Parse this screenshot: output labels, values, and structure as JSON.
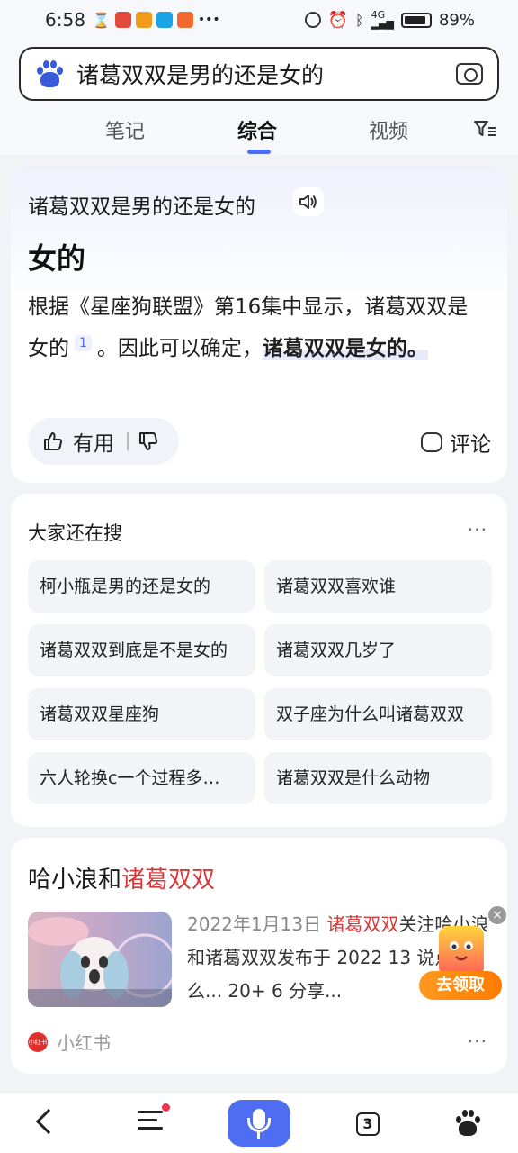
{
  "status_bar": {
    "time": "6:58",
    "battery": "89%",
    "battery_level": 0.89,
    "network": "4G"
  },
  "search": {
    "query": "诸葛双双是男的还是女的"
  },
  "tabs": [
    {
      "label": "笔记"
    },
    {
      "label": "综合",
      "active": true
    },
    {
      "label": "视频"
    }
  ],
  "answer": {
    "question": "诸葛双双是男的还是女的",
    "short_answer": "女的",
    "body_part1": "根据《星座狗联盟》第16集中显示，诸葛双双是女的",
    "citation": "1",
    "body_part2": "。因此可以确定，",
    "body_highlight": "诸葛双双是女的。",
    "useful_label": "有用",
    "comment_label": "评论"
  },
  "related": {
    "title": "大家还在搜",
    "more": "···",
    "items": [
      "柯小瓶是男的还是女的",
      "诸葛双双喜欢谁",
      "诸葛双双到底是不是女的",
      "诸葛双双几岁了",
      "诸葛双双星座狗",
      "双子座为什么叫诸葛双双",
      "六人轮换c一个过程多…",
      "诸葛双双是什么动物"
    ]
  },
  "result": {
    "title_prefix": "哈小浪和",
    "title_highlight": "诸葛双双",
    "date": "2022年1月13日",
    "snippet_highlight": "诸葛双双",
    "snippet_rest": "关注哈小浪和诸葛双双发布于 2022 13 说点什么... 20+ 6 分享...",
    "source": "小红书",
    "source_logo": "小红书",
    "more": "···"
  },
  "promo": {
    "label": "去领取",
    "close": "×"
  },
  "bottom_nav": {
    "tab_count": "3"
  },
  "colors": {
    "accent": "#4e6ef2",
    "highlight_red": "#d93838"
  }
}
